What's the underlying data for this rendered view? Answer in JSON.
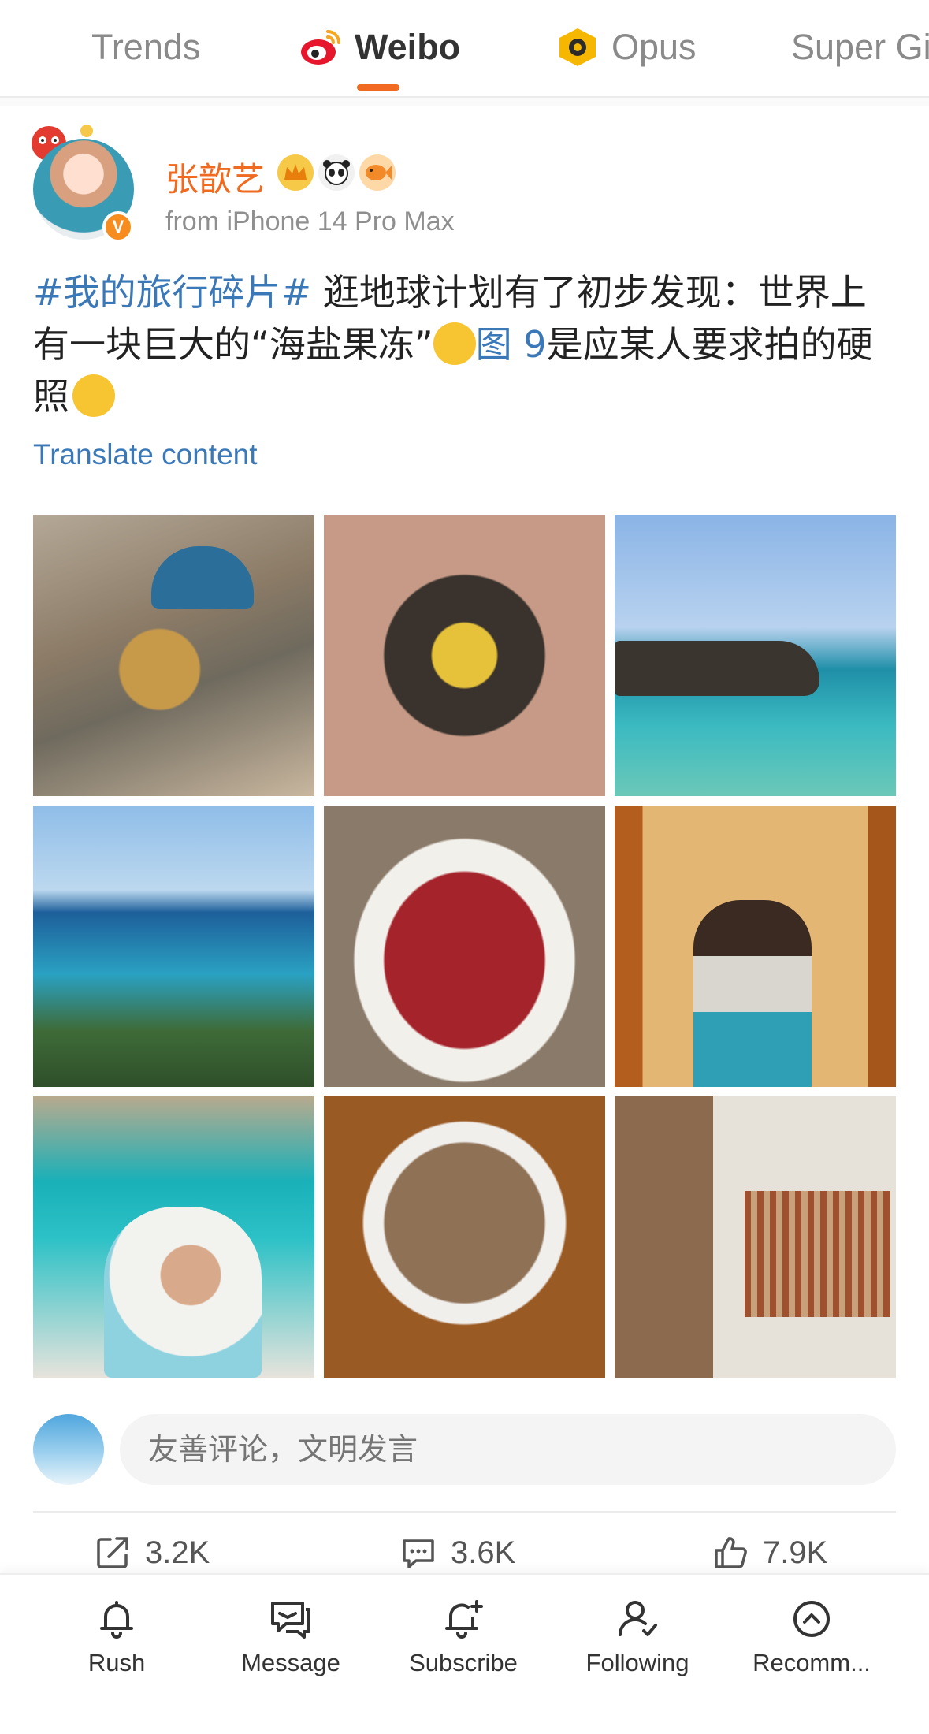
{
  "top_tabs": [
    {
      "label": "Trends"
    },
    {
      "label": "Weibo",
      "active": true
    },
    {
      "label": "Opus"
    },
    {
      "label": "Super Gi"
    }
  ],
  "post": {
    "username": "张歆艺",
    "source": "from iPhone 14 Pro Max",
    "hashtag": "#我的旅行碎片#",
    "text_part1": " 逛地球计划有了初步发现：世界上有一块巨大的“海盐果冻”",
    "link_text": "图 9",
    "text_part2": "是应某人要求拍的硬照",
    "translate_label": "Translate content",
    "photos": [
      {
        "name": "rocky-coast-arch"
      },
      {
        "name": "plated-dish"
      },
      {
        "name": "turquoise-cove"
      },
      {
        "name": "sea-cliffs"
      },
      {
        "name": "jamon-plate"
      },
      {
        "name": "family-hug-tram"
      },
      {
        "name": "selfie-beach"
      },
      {
        "name": "snails-plate"
      },
      {
        "name": "man-by-wall"
      }
    ]
  },
  "comment": {
    "placeholder": "友善评论，文明发言"
  },
  "actions": {
    "repost_count": "3.2K",
    "comment_count": "3.6K",
    "like_count": "7.9K"
  },
  "bottom_nav": [
    {
      "label": "Rush",
      "icon": "bell-icon"
    },
    {
      "label": "Message",
      "icon": "message-icon"
    },
    {
      "label": "Subscribe",
      "icon": "bell-plus-icon"
    },
    {
      "label": "Following",
      "icon": "user-check-icon"
    },
    {
      "label": "Recomm..."
    }
  ],
  "colors": {
    "accent": "#f06a1f",
    "link": "#3b78b8"
  }
}
